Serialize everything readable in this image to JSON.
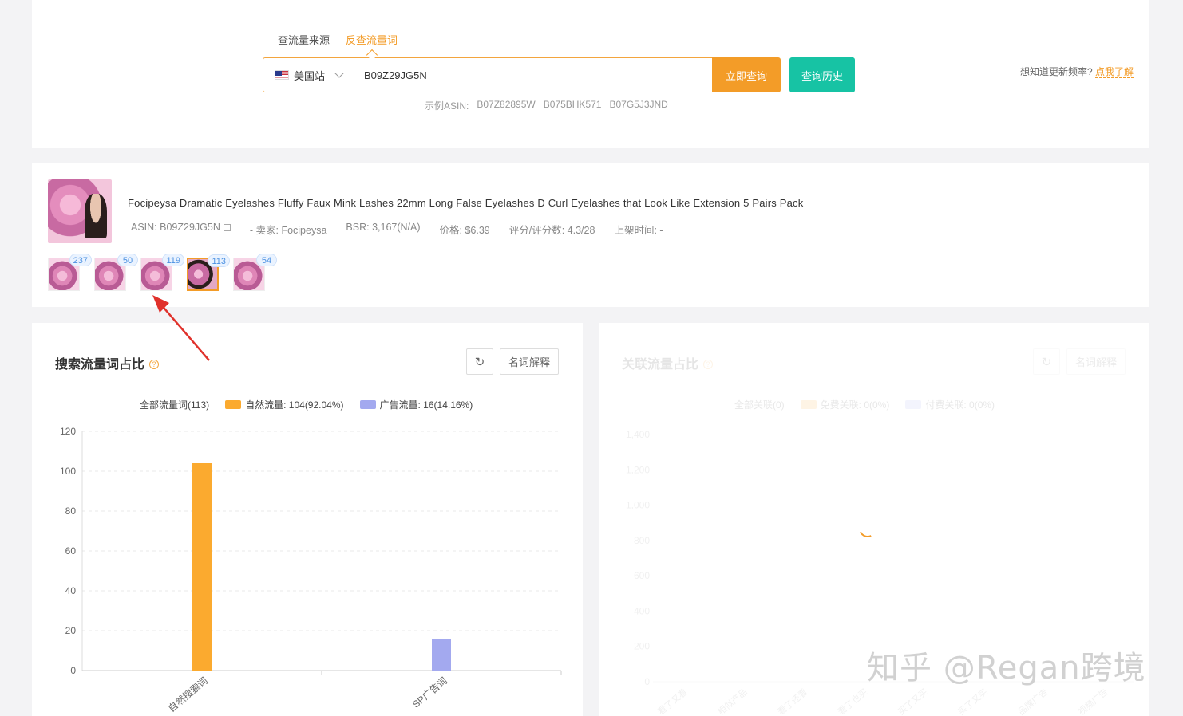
{
  "search": {
    "tabs": [
      "查流量来源",
      "反查流量词"
    ],
    "active_tab": 1,
    "site_label": "美国站",
    "asin_value": "B09Z29JG5N",
    "query_button": "立即查询",
    "history_button": "查询历史",
    "example_label": "示例ASIN:",
    "examples": [
      "B07Z82895W",
      "B075BHK571",
      "B07G5J3JND"
    ],
    "freq_question": "想知道更新频率?",
    "freq_link": "点我了解"
  },
  "product": {
    "title": "Focipeysa Dramatic Eyelashes Fluffy Faux Mink Lashes 22mm Long False Eyelashes D Curl Eyelashes that Look Like Extension 5 Pairs Pack",
    "asin": "ASIN: B09Z29JG5N",
    "seller": "- 卖家: Focipeysa",
    "bsr": "BSR: 3,167(N/A)",
    "price": "价格: $6.39",
    "rating": "评分/评分数: 4.3/28",
    "listed": "上架时间: -",
    "variants": [
      {
        "count": "237"
      },
      {
        "count": "50"
      },
      {
        "count": "119"
      },
      {
        "count": "113",
        "selected": true
      },
      {
        "count": "54"
      }
    ]
  },
  "left_panel": {
    "title": "搜索流量词占比",
    "gloss_button": "名词解释",
    "legend": {
      "all": "全部流量词(113)",
      "organic": "自然流量: 104(92.04%)",
      "ad": "广告流量: 16(14.16%)"
    }
  },
  "right_panel": {
    "title": "关联流量占比",
    "gloss_button": "名词解释",
    "legend": {
      "all": "全部关联(0)",
      "free": "免费关联: 0(0%)",
      "paid": "付费关联: 0(0%)"
    },
    "categories": [
      "看了又看",
      "相似产品",
      "看了还看",
      "看了也买",
      "买了又买",
      "买了又买",
      "品牌广告",
      "视频广告"
    ],
    "yticks": [
      "0",
      "200",
      "400",
      "600",
      "800",
      "1,000",
      "1,200",
      "1,400"
    ]
  },
  "chart_data": {
    "type": "bar",
    "categories": [
      "自然搜索词",
      "SP广告词"
    ],
    "series": [
      {
        "name": "自然流量",
        "values": [
          104,
          0
        ],
        "color": "#fbaa2f"
      },
      {
        "name": "广告流量",
        "values": [
          0,
          16
        ],
        "color": "#a3a9ef"
      }
    ],
    "ylim": [
      0,
      120
    ],
    "yticks": [
      0,
      20,
      40,
      60,
      80,
      100,
      120
    ],
    "grid": true,
    "legend": "top"
  },
  "watermark": "知乎 @Regan跨境"
}
